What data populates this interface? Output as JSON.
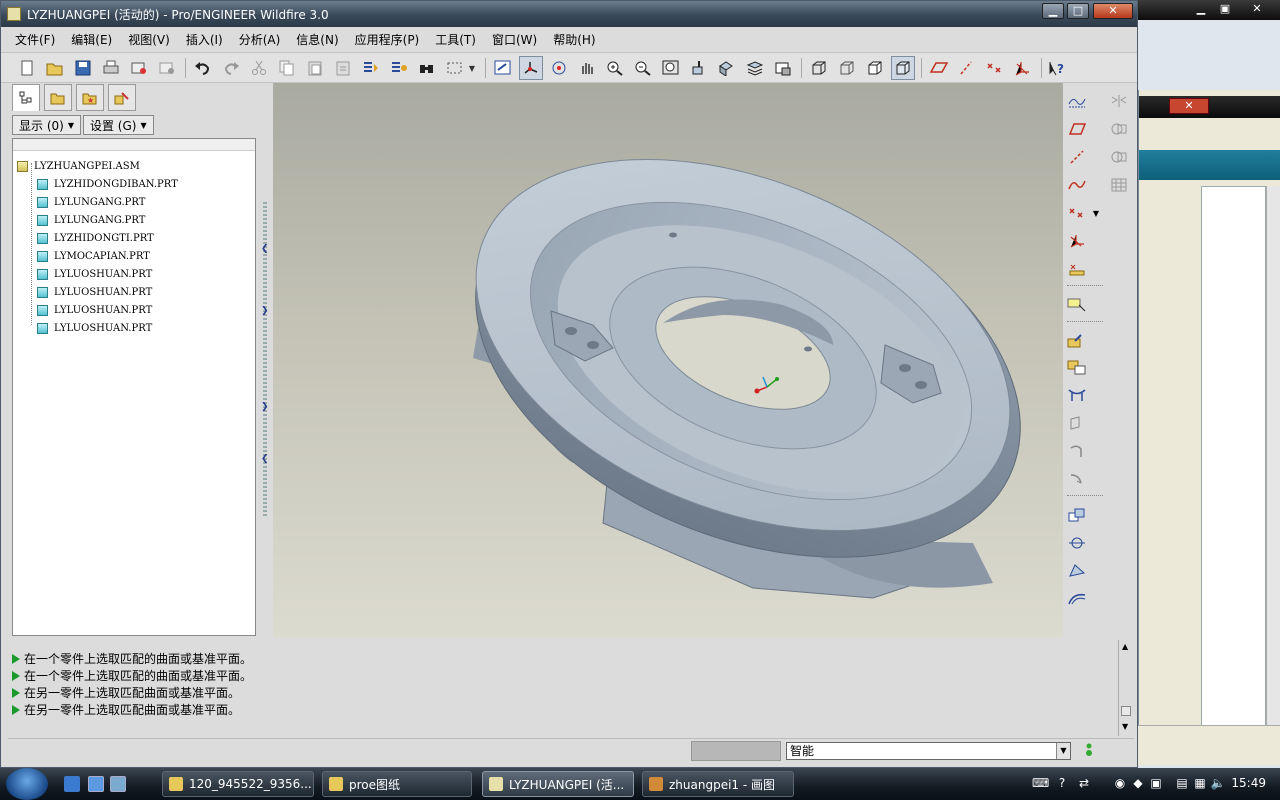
{
  "window": {
    "title": "LYZHUANGPEI (活动的) - Pro/ENGINEER Wildfire 3.0",
    "minimize": "▁",
    "maximize": "□",
    "close": "✕"
  },
  "menu": [
    "文件(F)",
    "编辑(E)",
    "视图(V)",
    "插入(I)",
    "分析(A)",
    "信息(N)",
    "应用程序(P)",
    "工具(T)",
    "窗口(W)",
    "帮助(H)"
  ],
  "toolbar_icons": [
    "new-icon",
    "open-icon",
    "save-icon",
    "print-icon",
    "send-icon",
    "mail-icon",
    "undo-icon",
    "redo-icon",
    "cut-icon",
    "copy-icon",
    "paste-icon",
    "paste-special-icon",
    "regenerate-icon",
    "regenerate-manager-icon",
    "find-icon",
    "select-box-icon",
    "repaint-icon",
    "spin-center-icon",
    "orient-mode-icon",
    "pan-icon",
    "zoom-in-icon",
    "zoom-out-icon",
    "refit-icon",
    "reorient-icon",
    "saved-views-icon",
    "layers-icon",
    "view-manager-icon",
    "wireframe-icon",
    "hidden-line-icon",
    "no-hidden-icon",
    "shading-icon",
    "datum-planes-icon",
    "datum-axes-icon",
    "datum-points-icon",
    "coordinate-systems-icon",
    "context-help-icon"
  ],
  "left_panel": {
    "tabs": [
      "model-tree-tab",
      "folder-browser-tab",
      "favorites-tab",
      "connections-tab"
    ],
    "show_label": "显示 (0)",
    "settings_label": "设置 (G)",
    "tree": [
      "LYZHUANGPEI.ASM",
      "LYZHIDONGDIBAN.PRT",
      "LYLUNGANG.PRT",
      "LYLUNGANG.PRT",
      "LYZHIDONGTI.PRT",
      "LYMOCAPIAN.PRT",
      "LYLUOSHUAN.PRT",
      "LYLUOSHUAN.PRT",
      "LYLUOSHUAN.PRT",
      "LYLUOSHUAN.PRT"
    ]
  },
  "messages": [
    "在一个零件上选取匹配的曲面或基准平面。",
    "在一个零件上选取匹配的曲面或基准平面。",
    "在另一零件上选取匹配曲面或基准平面。",
    "在另一零件上选取匹配曲面或基准平面。"
  ],
  "status": {
    "filter": "智能"
  },
  "taskbar": {
    "tasks": [
      "120_945522_9356...",
      "proe图纸",
      "LYZHUANGPEI (活...",
      "zhuangpei1 - 画图"
    ],
    "clock": "15:49"
  },
  "colors": {
    "model_surface": "#b8c4d0",
    "viewport_top": "#a9aaa0",
    "viewport_bottom": "#dcdbd0",
    "message_arrow": "#1a9a2a"
  }
}
